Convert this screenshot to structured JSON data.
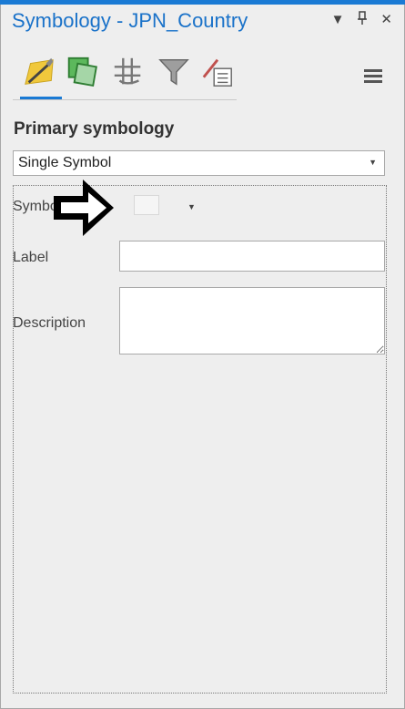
{
  "window": {
    "title": "Symbology - JPN_Country",
    "controls": {
      "dropdown": "▼",
      "pin": "🖈",
      "close": "✕"
    }
  },
  "tabs": [
    {
      "name": "primary-symbology",
      "icon": "paintbrush-polygon-icon"
    },
    {
      "name": "vary-symbology",
      "icon": "layered-squares-icon"
    },
    {
      "name": "symbol-layer-drawing",
      "icon": "hashed-layers-icon"
    },
    {
      "name": "symbol-classes",
      "icon": "filter-icon"
    },
    {
      "name": "symbol-properties",
      "icon": "brush-list-icon"
    }
  ],
  "colors": {
    "accent": "#1a7ad4",
    "title": "#1a72c9",
    "background": "#eeeeee"
  },
  "primary": {
    "section_title": "Primary symbology",
    "symbology_type": "Single Symbol",
    "symbol_label": "Symbol",
    "label_label": "Label",
    "label_value": "",
    "description_label": "Description",
    "description_value": ""
  }
}
